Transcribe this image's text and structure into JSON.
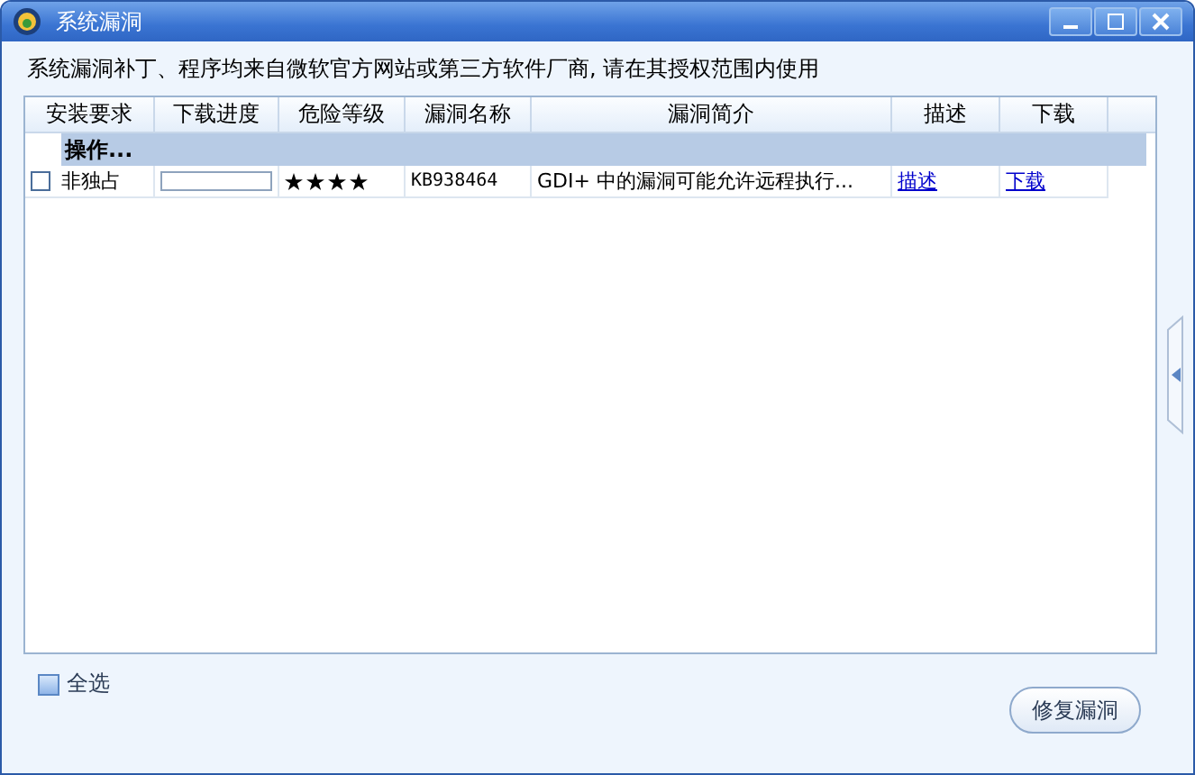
{
  "window": {
    "title": "系统漏洞"
  },
  "notice": "系统漏洞补丁、程序均来自微软官方网站或第三方软件厂商, 请在其授权范围内使用",
  "table": {
    "columns": [
      "安装要求",
      "下载进度",
      "危险等级",
      "漏洞名称",
      "漏洞简介",
      "描述",
      "下载"
    ],
    "groups": [
      {
        "label": "操作...",
        "rows": [
          {
            "checked": false,
            "requirement": "非独占",
            "level": 0,
            "stars": 4,
            "name": "KB938464",
            "summary": "GDI+ 中的漏洞可能允许远程执行...",
            "description_link": "描述",
            "download_link": "下载"
          }
        ]
      }
    ]
  },
  "select_all": {
    "label": "全选",
    "checked": false
  },
  "buttons": [
    "修复漏洞"
  ]
}
